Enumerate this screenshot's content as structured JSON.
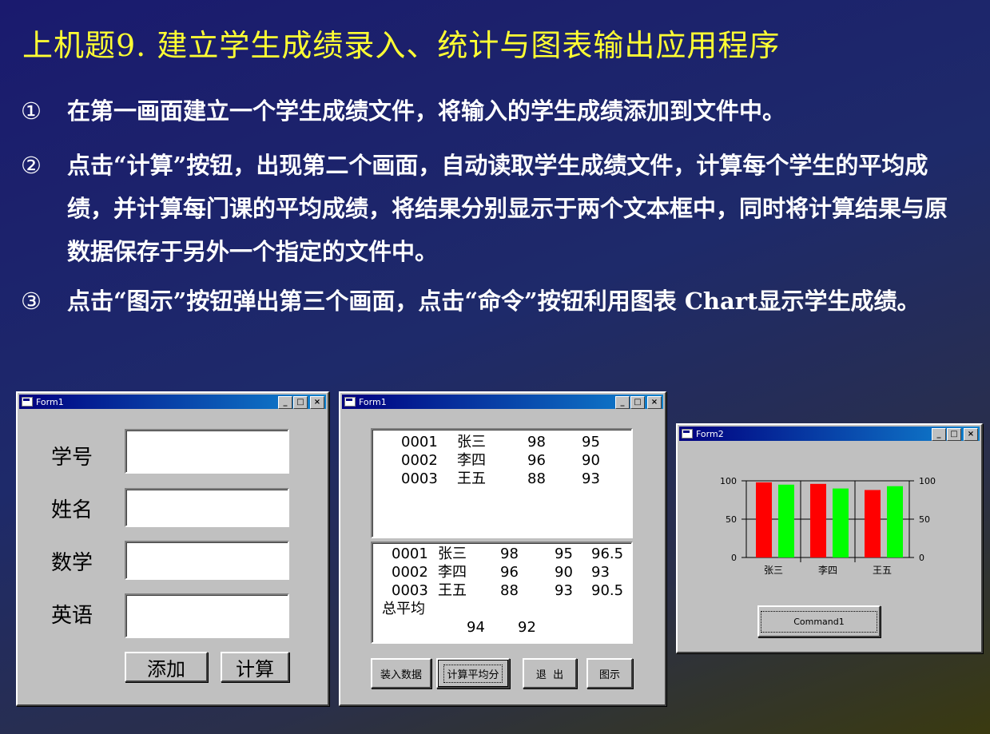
{
  "slide": {
    "title": "上机题9. 建立学生成绩录入、统计与图表输出应用程序",
    "items": [
      {
        "num": "①",
        "text": "在第一画面建立一个学生成绩文件，将输入的学生成绩添加到文件中。"
      },
      {
        "num": "②",
        "text": "点击“计算”按钮，出现第二个画面，自动读取学生成绩文件，计算每个学生的平均成绩，并计算每门课的平均成绩，将结果分别显示于两个文本框中，同时将计算结果与原数据保存于另外一个指定的文件中。"
      },
      {
        "num": "③",
        "text": "点击“图示”按钮弹出第三个画面，点击“命令”按钮利用图表 Chart显示学生成绩。"
      }
    ]
  },
  "form1": {
    "title": "Form1",
    "labels": {
      "id": "学号",
      "name": "姓名",
      "math": "数学",
      "english": "英语"
    },
    "buttons": {
      "add": "添加",
      "calc": "计算"
    }
  },
  "form1b": {
    "title": "Form1",
    "top_rows": [
      [
        "0001",
        "张三",
        "98",
        "95"
      ],
      [
        "0002",
        "李四",
        "96",
        "90"
      ],
      [
        "0003",
        "王五",
        "88",
        "93"
      ]
    ],
    "bottom_rows": [
      [
        "0001",
        "张三",
        "98",
        "95",
        "96.5"
      ],
      [
        "0002",
        "李四",
        "96",
        "90",
        "93"
      ],
      [
        "0003",
        "王五",
        "88",
        "93",
        "90.5"
      ]
    ],
    "avg_row": [
      "总平均",
      "94",
      "92"
    ],
    "buttons": {
      "load": "装入数据",
      "avg": "计算平均分",
      "exit": "退  出",
      "chart": "图示"
    }
  },
  "form2": {
    "title": "Form2",
    "button": "Command1",
    "colors": {
      "series1": "#ff0000",
      "series2": "#00ff00"
    }
  },
  "chart_data": {
    "type": "bar",
    "categories": [
      "张三",
      "李四",
      "王五"
    ],
    "series": [
      {
        "values": [
          98,
          96,
          88
        ]
      },
      {
        "values": [
          95,
          90,
          93
        ]
      }
    ],
    "ylim": [
      0,
      100
    ],
    "yticks": [
      "0",
      "50",
      "100"
    ],
    "grid": true
  }
}
